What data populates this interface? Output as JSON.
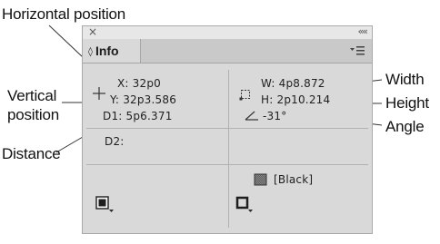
{
  "callouts": {
    "horizontal_position": "Horizontal position",
    "vertical_position_line1": "Vertical",
    "vertical_position_line2": "position",
    "distance": "Distance",
    "width": "Width",
    "height": "Height",
    "angle": "Angle"
  },
  "panel": {
    "title_close_glyph": "×",
    "title_collapse_glyph": "««",
    "tab_label": "Info",
    "tab_updown_glyph": "◊",
    "menu_icon": "panel-menu-icon"
  },
  "readouts": {
    "x": "X: 32p0",
    "y": "Y: 32p3.586",
    "d1": "D1: 5p6.371",
    "d2": "D2:",
    "w": "W: 4p8.872",
    "h": "H: 2p10.214",
    "angle": "-31°"
  },
  "swatches": {
    "stroke_color_name": "[Black]",
    "fill_color": "#1e1e1e"
  },
  "icons": {
    "crosshair": "crosshair-icon",
    "bounding_box": "bounding-box-icon",
    "angle": "angle-icon",
    "fill_swatch": "fill-swatch-icon",
    "stroke_swatch": "stroke-swatch-icon",
    "color_chip": "color-chip-icon"
  }
}
